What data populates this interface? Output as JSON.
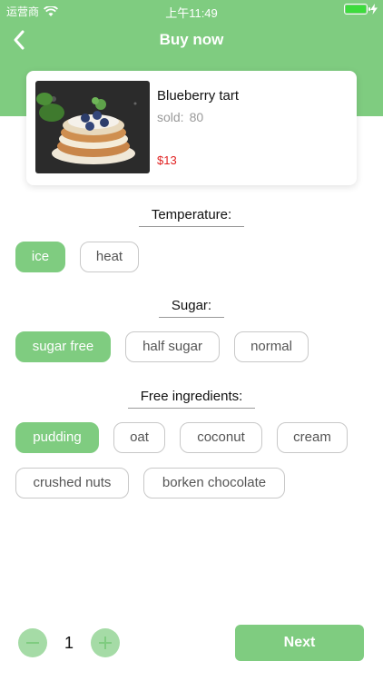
{
  "status_bar": {
    "carrier": "运营商",
    "time": "上午11:49"
  },
  "nav": {
    "title": "Buy now",
    "back_icon": "chevron-left-icon"
  },
  "product": {
    "name": "Blueberry tart",
    "sold_label": "sold:",
    "sold_count": "80",
    "price": "$13"
  },
  "sections": {
    "temperature": {
      "title": "Temperature:",
      "options": [
        "ice",
        "heat"
      ],
      "selected": "ice"
    },
    "sugar": {
      "title": "Sugar:",
      "options": [
        "sugar free",
        "half sugar",
        "normal"
      ],
      "selected": "sugar free"
    },
    "ingredients": {
      "title": "Free ingredients:",
      "options": [
        "pudding",
        "oat",
        "coconut",
        "cream",
        "crushed nuts",
        "borken chocolate"
      ],
      "selected": "pudding"
    }
  },
  "quantity": {
    "value": "1"
  },
  "footer": {
    "next_label": "Next"
  },
  "colors": {
    "accent": "#7fcc80",
    "price": "#e02020"
  }
}
